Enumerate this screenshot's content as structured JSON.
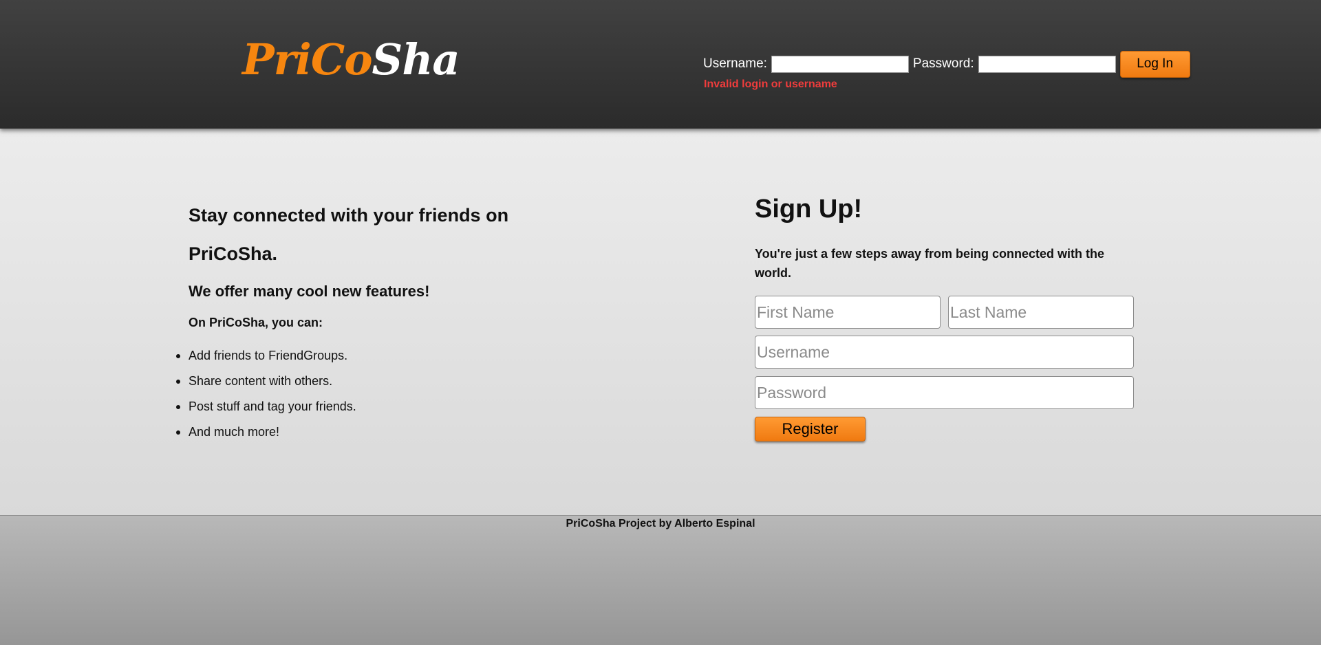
{
  "brand": {
    "logo_parts": [
      "Pri",
      "Co",
      "Sha"
    ],
    "accent_color": "#f7860f"
  },
  "login": {
    "username_label": "Username:",
    "username_value": "",
    "password_label": "Password:",
    "password_value": "",
    "button_label": "Log In",
    "error_message": "Invalid login or username",
    "error_color": "#f03c3c"
  },
  "intro": {
    "headline": "Stay connected with your friends on PriCoSha.",
    "subheading": "We offer many cool new features!",
    "features_intro": "On PriCoSha, you can:",
    "features": [
      "Add friends to FriendGroups.",
      "Share content with others.",
      "Post stuff and tag your friends.",
      "And much more!"
    ]
  },
  "signup": {
    "title": "Sign Up!",
    "description": "You're just a few steps away from being connected with the world.",
    "first_name_placeholder": "First Name",
    "last_name_placeholder": "Last Name",
    "username_placeholder": "Username",
    "password_placeholder": "Password",
    "register_label": "Register"
  },
  "footer": {
    "text": "PriCoSha Project by Alberto Espinal"
  }
}
